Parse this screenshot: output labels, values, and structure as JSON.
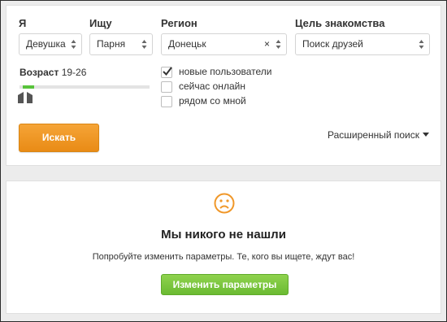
{
  "filters": {
    "i_am": {
      "label": "Я",
      "value": "Девушка"
    },
    "seeking": {
      "label": "Ищу",
      "value": "Парня"
    },
    "region": {
      "label": "Регион",
      "value": "Донецьк",
      "clear_symbol": "×"
    },
    "goal": {
      "label": "Цель знакомства",
      "value": "Поиск друзей"
    }
  },
  "age": {
    "label": "Возраст",
    "range_text": "19-26"
  },
  "checkboxes": [
    {
      "label": "новые пользователи",
      "checked": true
    },
    {
      "label": "сейчас онлайн",
      "checked": false
    },
    {
      "label": "рядом со мной",
      "checked": false
    }
  ],
  "search_button": "Искать",
  "advanced_search": "Расширенный поиск",
  "no_results": {
    "title": "Мы никого не нашли",
    "subtitle": "Попробуйте изменить параметры. Те, кого вы ищете, ждут вас!",
    "button": "Изменить параметры"
  },
  "colors": {
    "orange_button": "#f0982a",
    "green_button": "#78c13b",
    "sad_icon": "#f0982a",
    "slider_fill": "#58c33b"
  }
}
